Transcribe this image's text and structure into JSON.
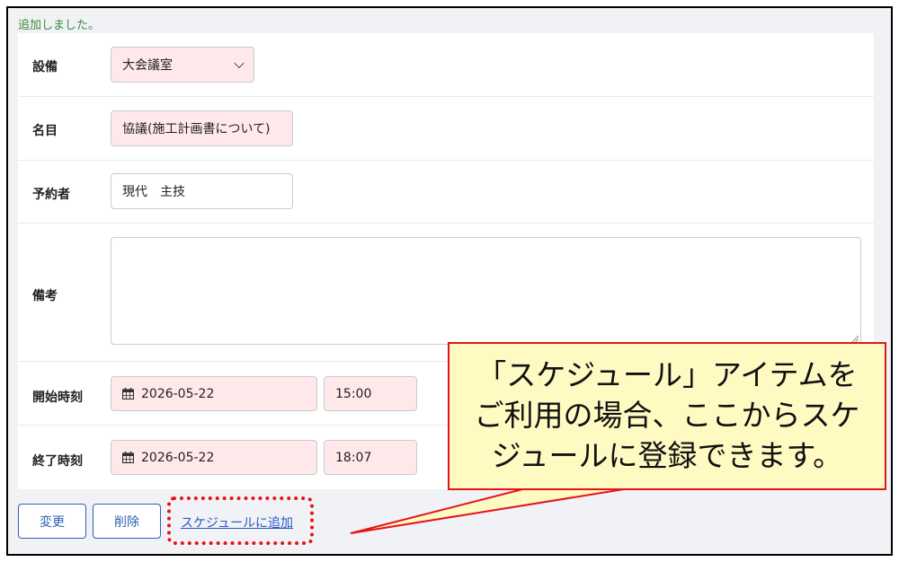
{
  "flash_message": "追加しました。",
  "form": {
    "equipment": {
      "label": "設備",
      "value": "大会議室"
    },
    "title": {
      "label": "名目",
      "value": "協議(施工計画書について)"
    },
    "booker": {
      "label": "予約者",
      "value": "現代　主技"
    },
    "notes": {
      "label": "備考",
      "value": ""
    },
    "start": {
      "label": "開始時刻",
      "date": "2026-05-22",
      "time": "15:00"
    },
    "end": {
      "label": "終了時刻",
      "date": "2026-05-22",
      "time": "18:07"
    }
  },
  "actions": {
    "change_label": "変更",
    "delete_label": "削除",
    "add_schedule_link": "スケジュールに追加"
  },
  "callout": {
    "line1": "「スケジュール」アイテムを",
    "line2": "ご利用の場合、ここからスケ",
    "line3": "ジュールに登録できます。"
  },
  "colors": {
    "required_field_bg": "#ffe8ea",
    "accent_blue": "#2f5fb3",
    "annotation_red": "#e3141b",
    "callout_bg": "#fff9c2",
    "success_green": "#3a8a3a"
  }
}
